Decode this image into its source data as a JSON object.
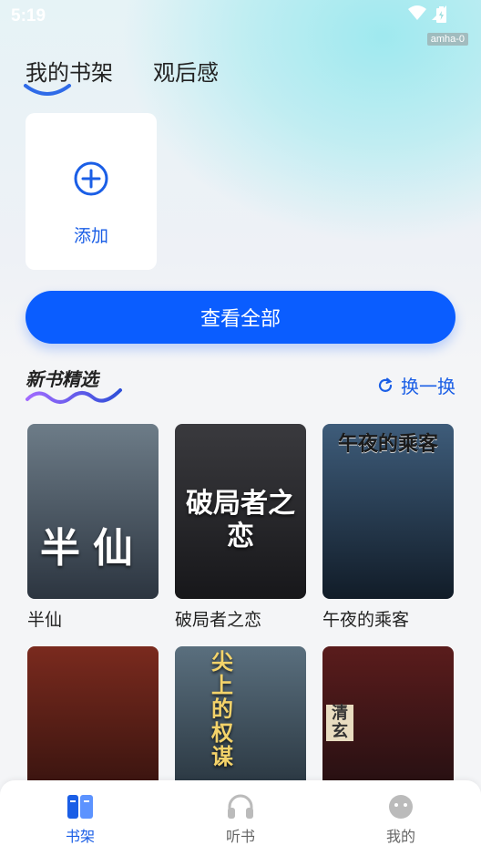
{
  "status_bar": {
    "time": "5:19",
    "device_tag": "amha-0"
  },
  "tabs": [
    {
      "label": "我的书架"
    },
    {
      "label": "观后感"
    }
  ],
  "shelf": {
    "add_label": "添加",
    "view_all_label": "查看全部"
  },
  "section": {
    "title": "新书精选",
    "refresh_label": "换一换"
  },
  "books": [
    {
      "title": "半仙",
      "cover_text": "半仙",
      "cover_colors": [
        "#6d7c88",
        "#2c3540"
      ]
    },
    {
      "title": "破局者之恋",
      "cover_text": "破局者之恋",
      "cover_colors": [
        "#3a3a3e",
        "#17171a"
      ]
    },
    {
      "title": "午夜的乘客",
      "cover_text": "午夜的乘客",
      "cover_colors": [
        "#3e5c7a",
        "#111c28"
      ]
    },
    {
      "title": "",
      "cover_text": "",
      "cover_colors": [
        "#7a2a1e",
        "#2a0f0c"
      ]
    },
    {
      "title": "",
      "cover_text": "尖上的权谋",
      "cover_colors": [
        "#5a6f7e",
        "#1f2a33"
      ]
    },
    {
      "title": "",
      "cover_text": "清玄",
      "cover_colors": [
        "#5a1c1c",
        "#1a0d10"
      ]
    }
  ],
  "nav": [
    {
      "label": "书架",
      "active": true,
      "icon": "bookshelf-icon"
    },
    {
      "label": "听书",
      "active": false,
      "icon": "headphones-icon"
    },
    {
      "label": "我的",
      "active": false,
      "icon": "profile-icon"
    }
  ],
  "colors": {
    "accent": "#0a5dff",
    "text_blue": "#1a5ee6"
  }
}
